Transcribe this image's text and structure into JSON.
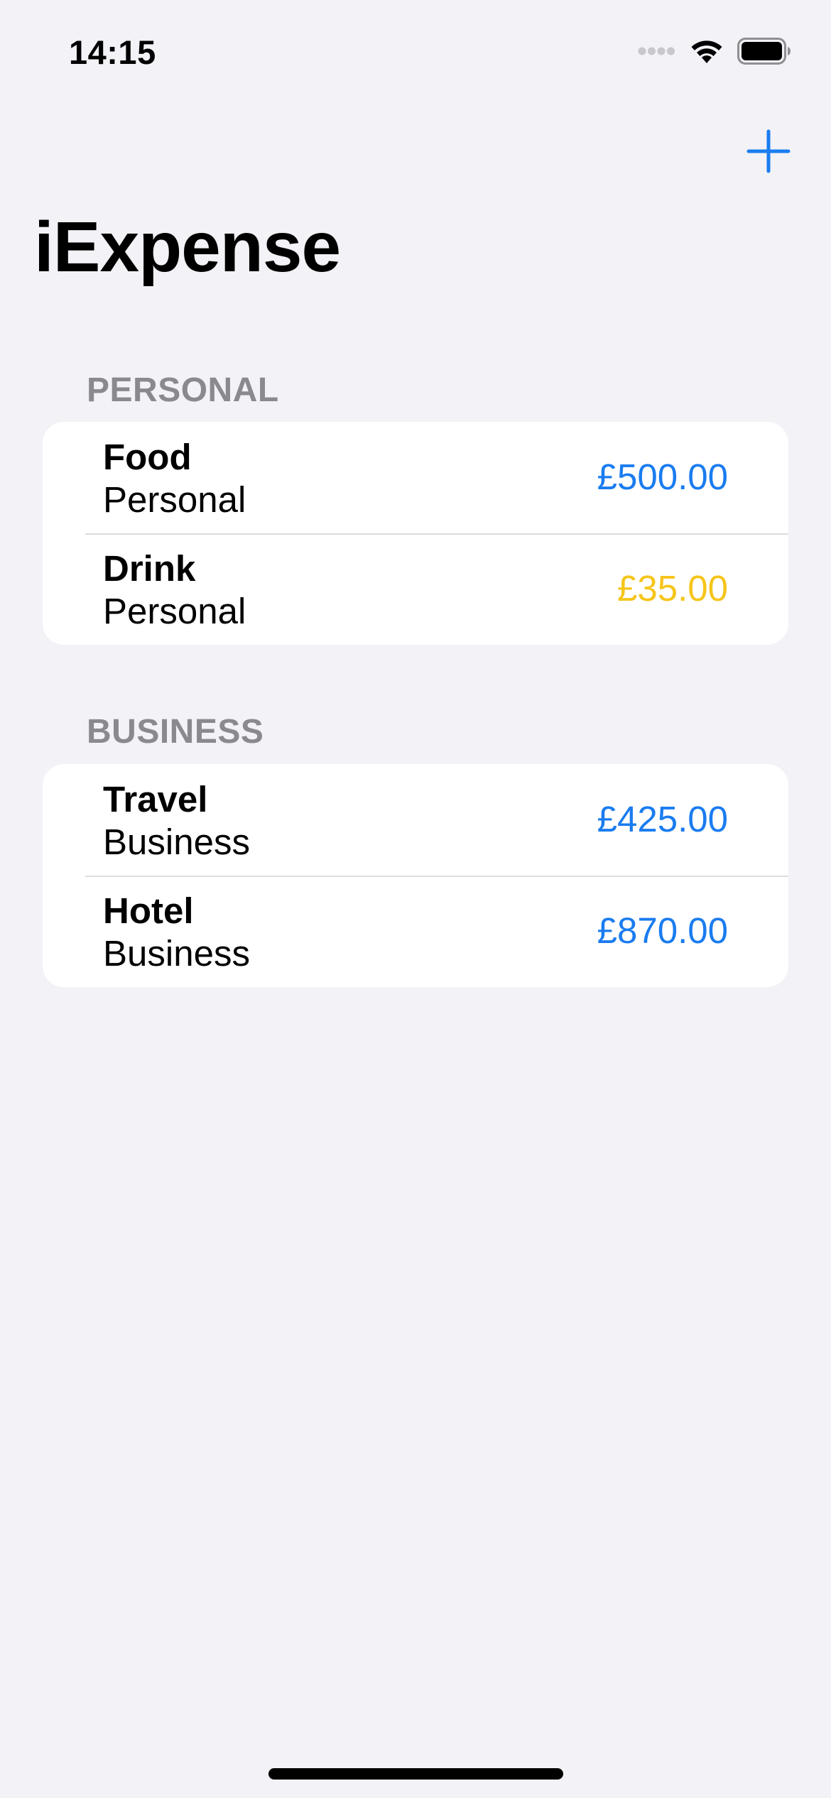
{
  "status_bar": {
    "time": "14:15",
    "icons": [
      "cellular-signal-icon",
      "wifi-icon",
      "battery-icon"
    ]
  },
  "nav": {
    "add_icon": "plus-icon",
    "title": "iExpense"
  },
  "colors": {
    "background": "#f2f2f7",
    "accent": "#1a7cf0",
    "amount_blue": "#1a7cf0",
    "amount_yellow": "#f6c51a",
    "section_header": "#8a8a8e"
  },
  "sections": [
    {
      "header": "PERSONAL",
      "items": [
        {
          "name": "Food",
          "type": "Personal",
          "amount": "£500.00",
          "amount_color": "#1a7cf0"
        },
        {
          "name": "Drink",
          "type": "Personal",
          "amount": "£35.00",
          "amount_color": "#f6c51a"
        }
      ]
    },
    {
      "header": "BUSINESS",
      "items": [
        {
          "name": "Travel",
          "type": "Business",
          "amount": "£425.00",
          "amount_color": "#1a7cf0"
        },
        {
          "name": "Hotel",
          "type": "Business",
          "amount": "£870.00",
          "amount_color": "#1a7cf0"
        }
      ]
    }
  ]
}
